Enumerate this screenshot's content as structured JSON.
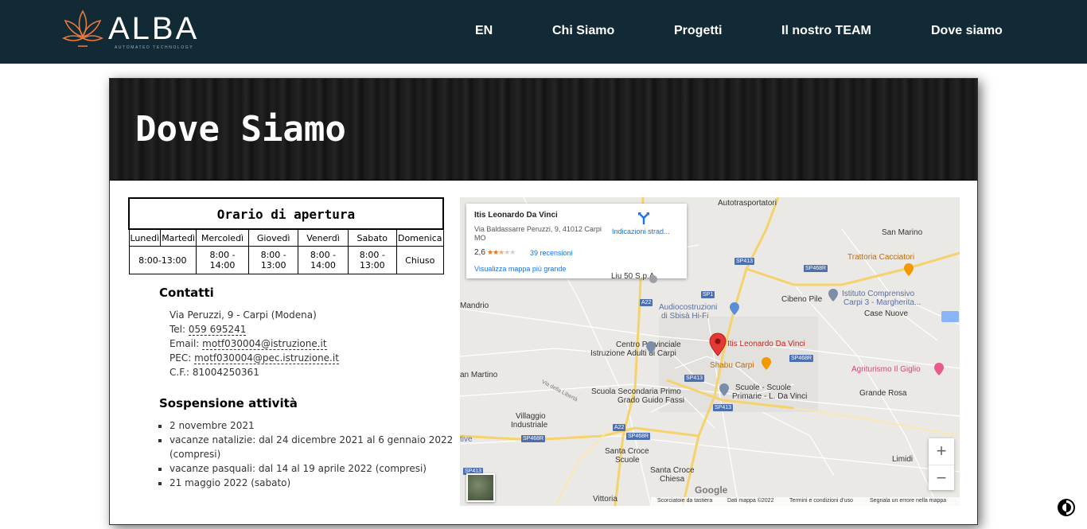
{
  "nav": {
    "logo_text": "ALBA",
    "logo_subtext": "AUTOMATED TECHNOLOGY",
    "items": [
      "EN",
      "Chi Siamo",
      "Progetti",
      "Il nostro TEAM",
      "Dove siamo"
    ]
  },
  "hero": {
    "title": "Dove Siamo"
  },
  "hours": {
    "title": "Orario di apertura",
    "days": [
      "Lunedì",
      "Martedì",
      "Mercoledì",
      "Giovedì",
      "Venerdì",
      "Sabato",
      "Domenica"
    ],
    "mon_tue": "8:00-13:00",
    "wed": "8:00 - 14:00",
    "thu": "8:00 - 13:00",
    "fri": "8:00 - 14:00",
    "sat": "8:00 - 13:00",
    "sun": "Chiuso"
  },
  "contacts": {
    "heading": "Contatti",
    "address": "Via Peruzzi, 9 - Carpi (Modena)",
    "tel_label": "Tel:",
    "tel": "059 695241",
    "email_label": "Email:",
    "email": "motf030004@istruzione.it",
    "pec_label": "PEC:",
    "pec": "motf030004@pec.istruzione.it",
    "cf": "C.F.: 81004250361"
  },
  "suspension": {
    "heading": "Sospensione attività",
    "items": [
      "2 novembre 2021",
      "vacanze natalizie: dal 24 dicembre 2021 al 6 gennaio 2022 (compresi)",
      "vacanze pasquali: dal 14 al 19 aprile 2022 (compresi)",
      "21 maggio 2022 (sabato)"
    ]
  },
  "map": {
    "place_name": "Itis Leonardo Da Vinci",
    "place_address": "Via Baldassarre Peruzzi, 9, 41012 Carpi MO",
    "rating": "2,6",
    "reviews": "39 recensioni",
    "directions": "Indicazioni strad...",
    "larger_map": "Visualizza mappa più grande",
    "labels": {
      "autotrasportatori": "Autotrasportatori",
      "san_marino_right": "San Marino",
      "trattoria": "Trattoria Cacciatori",
      "mandrio": "Mandrio",
      "audiocostruzioni_1": "Audiocostruzioni",
      "audiocostruzioni_2": "di Sbisà Hi-Fi",
      "cibeno": "Cibeno Pile",
      "istituto_1": "Istituto Comprensivo",
      "istituto_2": "Carpi 3 - Margherita...",
      "case_nuove": "Case Nuove",
      "centro_1": "Centro Provinciale",
      "centro_2": "Istruzione Adulti di Carpi",
      "marker_label": "Itis Leonardo Da Vinci",
      "shabu": "Shabu Carpi",
      "agriturismo": "Agriturismo Il Giglio",
      "san_martino": "an Martino",
      "scuola_1": "Scuola Secondaria Primo",
      "scuola_2": "Grado Guido Fassi",
      "scuole_1": "Scuole - Scuole",
      "scuole_2": "Primarie - L. Da Vinci",
      "grande_rosa": "Grande Rosa",
      "villaggio_1": "Villaggio",
      "villaggio_2": "Industriale",
      "santa_croce_1": "Santa Croce",
      "santa_croce_2": "Scuole",
      "santa_croce_chiesa_1": "Santa Croce",
      "santa_croce_chiesa_2": "Chiesa",
      "limidi": "Limidi",
      "vittoria": "Vittoria",
      "liu": "Liu 50 S.p.A",
      "tive": "tive",
      "della_liberta": "Via della Libertà"
    },
    "roads": [
      "SP413",
      "SP468R",
      "SP1",
      "A22",
      "SP468R",
      "SP413",
      "SP413",
      "A22",
      "SP468R",
      "SP468R",
      "SP413"
    ],
    "google": "Google",
    "footer": [
      "Scorciatoie da tastiera",
      "Dati mappa ©2022",
      "Termini e condizioni d'uso",
      "Segnala un errore nella mappa"
    ],
    "zoom_in": "+",
    "zoom_out": "−"
  },
  "colors": {
    "navbar_bg": "#122a35",
    "logo_accent": "#e87a3c",
    "marker": "#e53935",
    "link": "#1a73e8"
  }
}
